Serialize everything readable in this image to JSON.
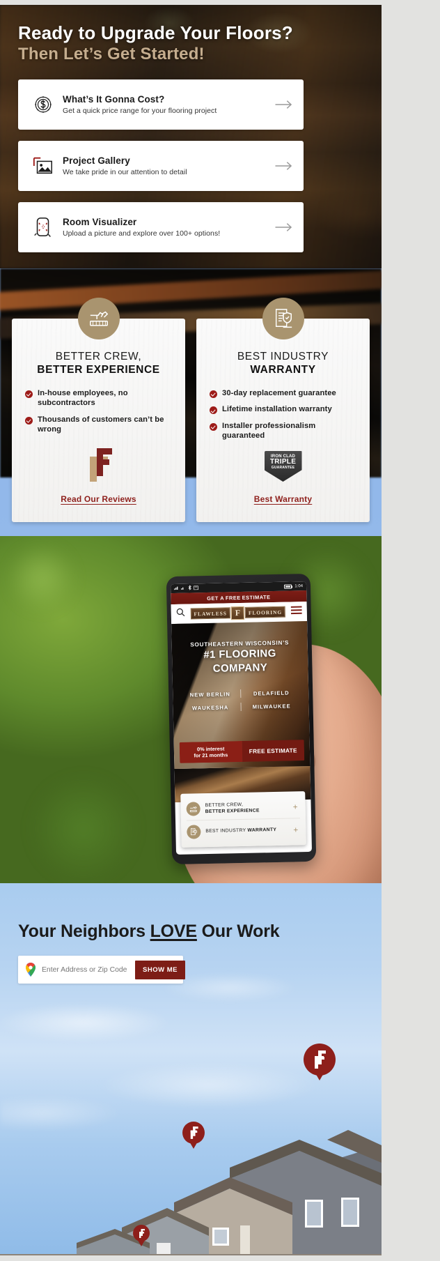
{
  "hero": {
    "heading_line1": "Ready to Upgrade Your Floors?",
    "heading_line2": "Then Let’s Get Started!",
    "accent_color": "#c5ad8e",
    "cards": [
      {
        "icon": "dollar-coin-icon",
        "title": "What’s It Gonna Cost?",
        "subtitle": "Get a quick price range for your flooring project",
        "arrow": "arrow-right-icon"
      },
      {
        "icon": "photo-gallery-icon",
        "title": "Project Gallery",
        "subtitle": "We take pride in our attention to detail",
        "arrow": "arrow-right-icon"
      },
      {
        "icon": "room-scan-phone-icon",
        "title": "Room Visualizer",
        "subtitle": "Upload a picture and explore over 100+ options!",
        "arrow": "arrow-right-icon"
      }
    ]
  },
  "features": {
    "cards": [
      {
        "badge_icon": "hammer-plank-icon",
        "title_line1": "BETTER CREW,",
        "title_line2": "BETTER EXPERIENCE",
        "bullets": [
          "In-house employees, no subcontractors",
          "Thousands of customers can’t be wrong"
        ],
        "media": "flawless-f-logo",
        "link": "Read Our Reviews"
      },
      {
        "badge_icon": "certificate-shield-icon",
        "title_line1": "BEST INDUSTRY",
        "title_line2": "WARRANTY",
        "bullets": [
          "30-day replacement guarantee",
          "Lifetime installation warranty",
          "Installer professionalism guaranteed"
        ],
        "media": "iron-clad-triple-guarantee-badge",
        "badge_text": {
          "line1": "IRON CLAD",
          "line2": "TRIPLE",
          "line3": "GUARANTEE"
        },
        "link": "Best Warranty"
      }
    ],
    "link_color": "#8e1f1b",
    "check_color": "#9d1b18",
    "badge_color": "#a9946f"
  },
  "phone": {
    "status": {
      "time": "1:04",
      "icons": [
        "signal-icon",
        "wifi-icon",
        "bluetooth-icon",
        "sd-card-icon",
        "battery-icon"
      ]
    },
    "promo_bar": {
      "pre": "GET A",
      "emphasis": "FREE",
      "post": "ESTIMATE"
    },
    "nav": {
      "search_icon": "search-icon",
      "menu_icon": "hamburger-menu-icon",
      "brand_left": "FLAWLESS",
      "brand_mark": "F",
      "brand_right": "FLOORING"
    },
    "hero": {
      "eyebrow": "SOUTHEASTERN WISCONSIN’S",
      "title_line1": "#1 FLOORING",
      "title_line2": "COMPANY",
      "cities": [
        "NEW BERLIN",
        "DELAFIELD",
        "WAUKESHA",
        "MILWAUKEE"
      ],
      "offer_line1": "0% interest",
      "offer_line2": "for 21 months",
      "cta": "FREE ESTIMATE"
    },
    "accordion": [
      {
        "icon": "hammer-plank-icon",
        "line1": "BETTER CREW,",
        "line2": "BETTER EXPERIENCE",
        "toggle": "+"
      },
      {
        "icon": "certificate-shield-icon",
        "line1": "BEST INDUSTRY ",
        "line2": "WARRANTY",
        "toggle": "+"
      }
    ]
  },
  "neighbors": {
    "heading_before": "Your Neighbors ",
    "heading_underlined": "LOVE",
    "heading_after": " Our Work",
    "search": {
      "pin_icon": "google-maps-pin-icon",
      "placeholder": "Enter Address or Zip Code",
      "value": "",
      "button_label": "SHOW ME",
      "button_color": "#7d1d16"
    },
    "map_pins": [
      "flawless-f-pin",
      "flawless-f-pin",
      "flawless-f-pin"
    ]
  }
}
